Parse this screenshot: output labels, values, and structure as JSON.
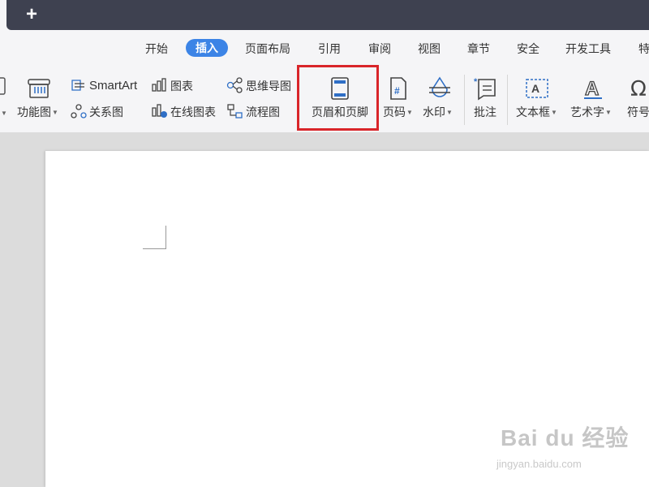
{
  "titlebar": {
    "new_tab_symbol": "+"
  },
  "menu": {
    "tabs": [
      {
        "label": "开始"
      },
      {
        "label": "插入",
        "active": true
      },
      {
        "label": "页面布局"
      },
      {
        "label": "引用"
      },
      {
        "label": "审阅"
      },
      {
        "label": "视图"
      },
      {
        "label": "章节"
      },
      {
        "label": "安全"
      },
      {
        "label": "开发工具"
      },
      {
        "label": "特"
      }
    ]
  },
  "toolbar": {
    "function_chart": "功能图",
    "smartart": "SmartArt",
    "relation_chart": "关系图",
    "chart": "图表",
    "online_chart": "在线图表",
    "mindmap": "思维导图",
    "flowchart": "流程图",
    "header_footer": "页眉和页脚",
    "page_number": "页码",
    "watermark": "水印",
    "comment": "批注",
    "textbox": "文本框",
    "wordart": "艺术字",
    "symbol": "符号"
  },
  "watermark_overlay": {
    "brand": "Bai du 经验",
    "url": "jingyan.baidu.com"
  },
  "colors": {
    "accent": "#3c84e6",
    "highlight": "#d9252a",
    "titlebar": "#3e4150",
    "icon": "#2f6fc6"
  }
}
